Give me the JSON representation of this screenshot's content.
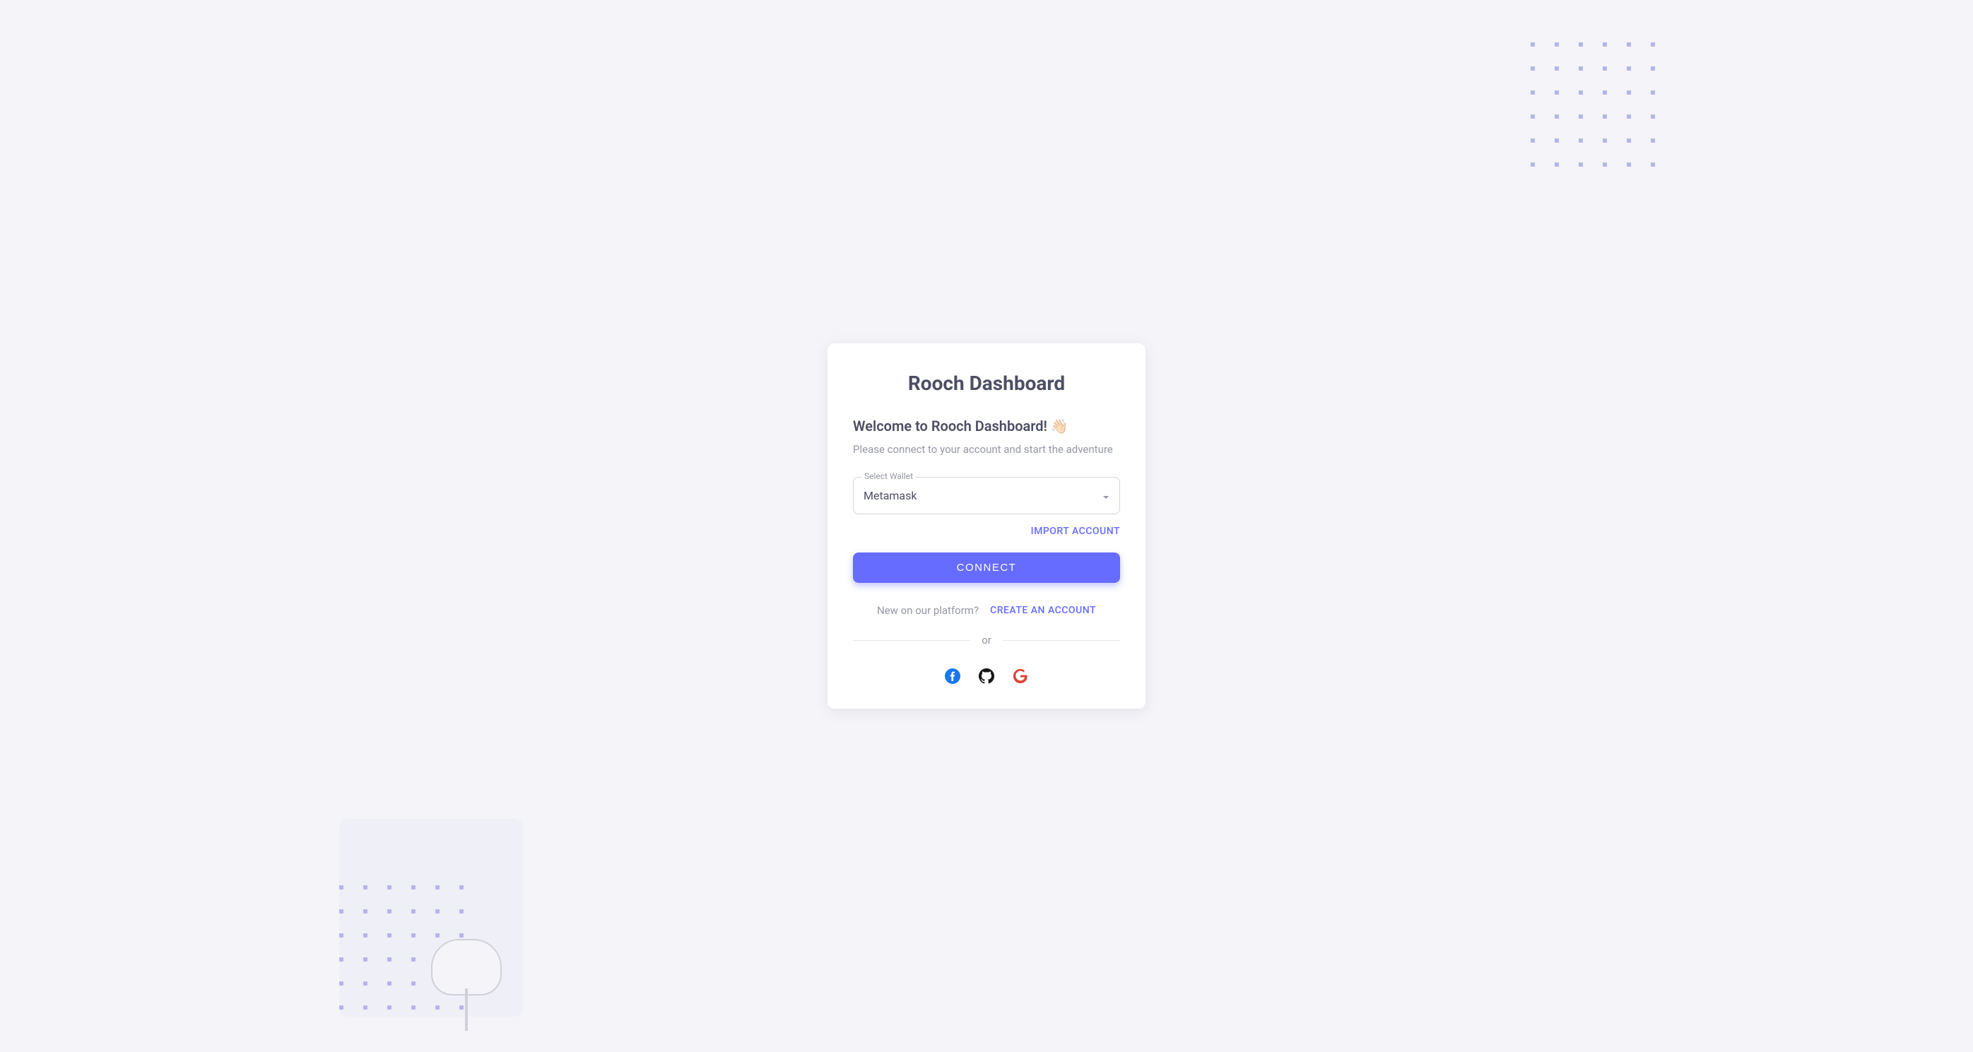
{
  "app": {
    "title": "Rooch Dashboard"
  },
  "welcome": {
    "heading": "Welcome to Rooch Dashboard! 👋🏻",
    "subtitle": "Please connect to your account and start the adventure"
  },
  "wallet": {
    "label": "Select Wallet",
    "selected": "Metamask"
  },
  "actions": {
    "import": "IMPORT ACCOUNT",
    "connect": "CONNECT"
  },
  "signup": {
    "prompt": "New on our platform?",
    "link": "CREATE AN ACCOUNT"
  },
  "divider": {
    "text": "or"
  },
  "colors": {
    "primary": "#666CFF",
    "background": "#F4F4F9",
    "textPrimary": "#4C4E64",
    "textSecondary": "#9597A5"
  }
}
